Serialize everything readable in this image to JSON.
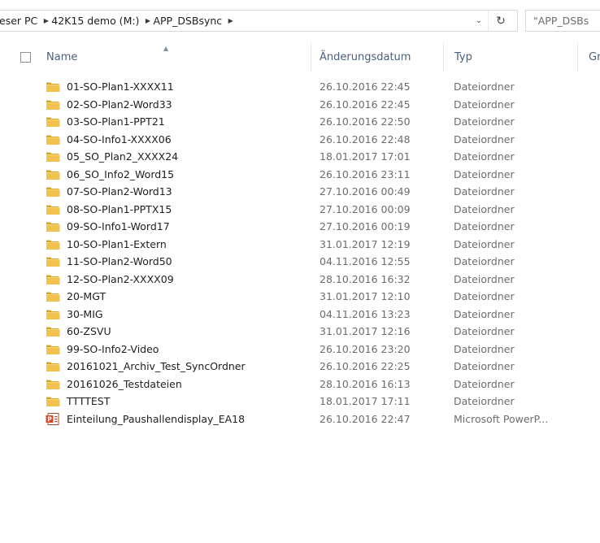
{
  "addressbar": {
    "crumbs": [
      "eser PC",
      "42K15 demo (M:)",
      "APP_DSBsync"
    ],
    "dropdown_icon": "chevron-down-icon",
    "refresh_icon": "refresh-icon"
  },
  "search": {
    "placeholder": "\"APP_DSBs"
  },
  "columns": {
    "name": "Name",
    "date": "Änderungsdatum",
    "type": "Typ",
    "size": "Gr"
  },
  "colors": {
    "header_text": "#4c607a",
    "folder_yellow": "#e8b93a",
    "secondary_text": "#6d6d6d"
  },
  "files": [
    {
      "name": "01-SO-Plan1-XXXX11",
      "date": "26.10.2016 22:45",
      "type": "Dateiordner",
      "icon": "folder-icon"
    },
    {
      "name": "02-SO-Plan2-Word33",
      "date": "26.10.2016 22:45",
      "type": "Dateiordner",
      "icon": "folder-icon"
    },
    {
      "name": "03-SO-Plan1-PPT21",
      "date": "26.10.2016 22:50",
      "type": "Dateiordner",
      "icon": "folder-icon"
    },
    {
      "name": "04-SO-Info1-XXXX06",
      "date": "26.10.2016 22:48",
      "type": "Dateiordner",
      "icon": "folder-icon"
    },
    {
      "name": "05_SO_Plan2_XXXX24",
      "date": "18.01.2017 17:01",
      "type": "Dateiordner",
      "icon": "folder-icon"
    },
    {
      "name": "06_SO_Info2_Word15",
      "date": "26.10.2016 23:11",
      "type": "Dateiordner",
      "icon": "folder-icon"
    },
    {
      "name": "07-SO-Plan2-Word13",
      "date": "27.10.2016 00:49",
      "type": "Dateiordner",
      "icon": "folder-icon"
    },
    {
      "name": "08-SO-Plan1-PPTX15",
      "date": "27.10.2016 00:09",
      "type": "Dateiordner",
      "icon": "folder-icon"
    },
    {
      "name": "09-SO-Info1-Word17",
      "date": "27.10.2016 00:19",
      "type": "Dateiordner",
      "icon": "folder-icon"
    },
    {
      "name": "10-SO-Plan1-Extern",
      "date": "31.01.2017 12:19",
      "type": "Dateiordner",
      "icon": "folder-icon"
    },
    {
      "name": "11-SO-Plan2-Word50",
      "date": "04.11.2016 12:55",
      "type": "Dateiordner",
      "icon": "folder-icon"
    },
    {
      "name": "12-SO-Plan2-XXXX09",
      "date": "28.10.2016 16:32",
      "type": "Dateiordner",
      "icon": "folder-icon"
    },
    {
      "name": "20-MGT",
      "date": "31.01.2017 12:10",
      "type": "Dateiordner",
      "icon": "folder-icon"
    },
    {
      "name": "30-MIG",
      "date": "04.11.2016 13:23",
      "type": "Dateiordner",
      "icon": "folder-icon"
    },
    {
      "name": "60-ZSVU",
      "date": "31.01.2017 12:16",
      "type": "Dateiordner",
      "icon": "folder-icon"
    },
    {
      "name": "99-SO-Info2-Video",
      "date": "26.10.2016 23:20",
      "type": "Dateiordner",
      "icon": "folder-icon"
    },
    {
      "name": "20161021_Archiv_Test_SyncOrdner",
      "date": "26.10.2016 22:25",
      "type": "Dateiordner",
      "icon": "folder-icon"
    },
    {
      "name": "20161026_Testdateien",
      "date": "28.10.2016 16:13",
      "type": "Dateiordner",
      "icon": "folder-icon"
    },
    {
      "name": "TTTTEST",
      "date": "18.01.2017 17:11",
      "type": "Dateiordner",
      "icon": "folder-icon"
    },
    {
      "name": "Einteilung_Paushallendisplay_EA18",
      "date": "26.10.2016 22:47",
      "type": "Microsoft PowerP...",
      "icon": "powerpoint-file-icon"
    }
  ]
}
